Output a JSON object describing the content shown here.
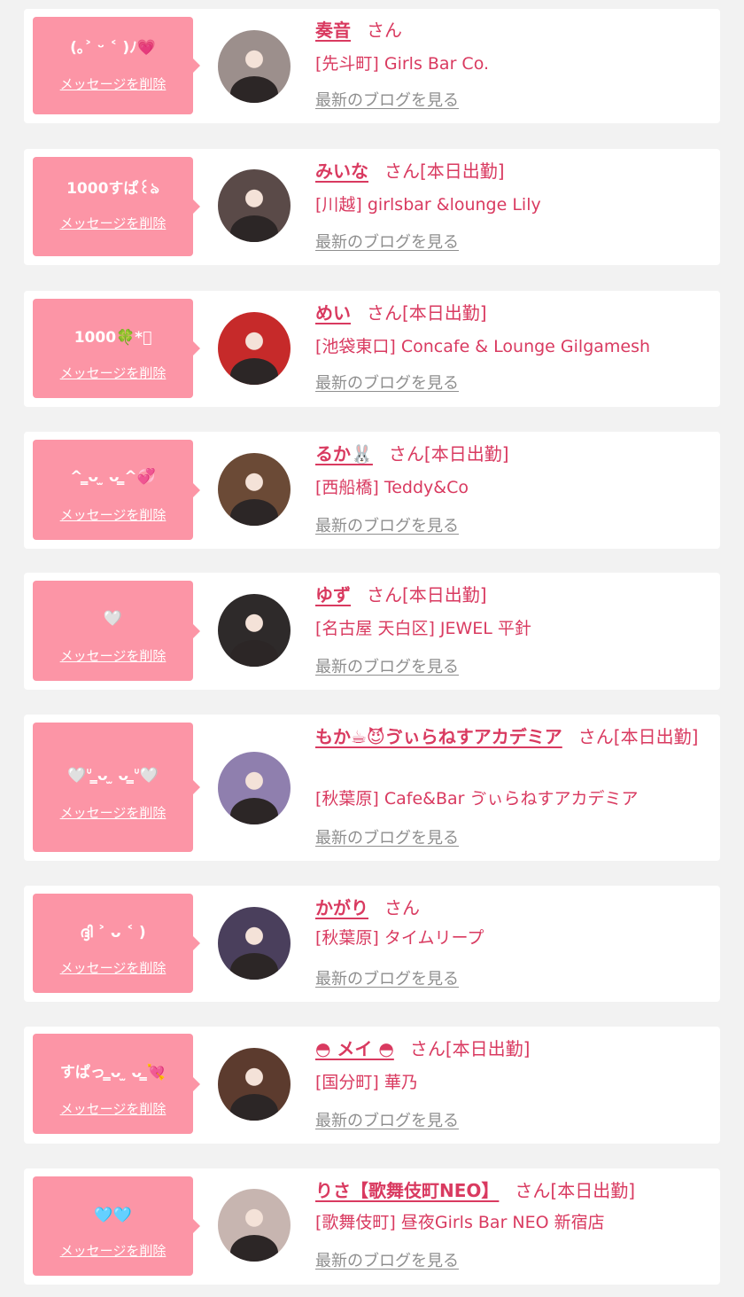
{
  "list": {
    "items": [
      {
        "message": "(｡˃ ᵕ ˂ )ﾉ💗",
        "delete_label": "メッセージを削除",
        "name": "奏音",
        "suffix": "さん",
        "shop": "[先斗町] Girls Bar Co.",
        "blog_label": "最新のブログを見る",
        "avatar_bg": "#9c8f8c"
      },
      {
        "message": "1000すぱ꒰ঌ",
        "delete_label": "メッセージを削除",
        "name": "みいな",
        "suffix": "さん[本日出勤]",
        "shop": "[川越] girlsbar &lounge Lily",
        "blog_label": "最新のブログを見る",
        "avatar_bg": "#5a4a48"
      },
      {
        "message": "1000🍀*ﾟ",
        "delete_label": "メッセージを削除",
        "name": "めい",
        "suffix": "さん[本日出勤]",
        "shop": "[池袋東口] Concafe & Lounge Gilgamesh",
        "blog_label": "最新のブログを見る",
        "avatar_bg": "#c62a2a"
      },
      {
        "message": "^ ̳ᴗ  ̫ ᴗ ̳^💞",
        "delete_label": "メッセージを削除",
        "name": "るか🐰",
        "suffix": "さん[本日出勤]",
        "shop": "[西船橋] Teddy&Co",
        "blog_label": "最新のブログを見る",
        "avatar_bg": "#6b4a36"
      },
      {
        "message": "🤍",
        "delete_label": "メッセージを削除",
        "name": "ゆず",
        "suffix": "さん[本日出勤]",
        "shop": "[名古屋 天白区] JEWEL 平針",
        "blog_label": "最新のブログを見る",
        "avatar_bg": "#2e2a2a"
      },
      {
        "message": "🤍ᐡ ̳ᴗ ̫ ᴗ ̳ᐡ🤍",
        "delete_label": "メッセージを削除",
        "name": "もか☕😈ゔぃらねすアカデミア",
        "suffix": "さん[本日出勤]",
        "shop": "[秋葉原] Cafe&Bar ゔぃらねすアカデミア",
        "blog_label": "最新のブログを見る",
        "avatar_bg": "#8f7fae"
      },
      {
        "message": "ദ്ദി ˃ ᴗ ˂ )",
        "delete_label": "メッセージを削除",
        "name": "かがり",
        "suffix": "さん",
        "shop": "[秋葉原] タイムリープ",
        "blog_label": "最新のブログを見る",
        "avatar_bg": "#4a3f5c"
      },
      {
        "message": "すぱっ ̳ᴗ ̫ ᴗ ̳💘",
        "delete_label": "メッセージを削除",
        "name": "◓ メイ ◓",
        "suffix": "さん[本日出勤]",
        "shop": "[国分町] 華乃",
        "blog_label": "最新のブログを見る",
        "avatar_bg": "#5c3b2e"
      },
      {
        "message": "🩵🩵",
        "delete_label": "メッセージを削除",
        "name": "りさ【歌舞伎町NEO】",
        "suffix": "さん[本日出勤]",
        "shop": "[歌舞伎町] 昼夜Girls Bar NEO 新宿店",
        "blog_label": "最新のブログを見る",
        "avatar_bg": "#c7b5b0"
      }
    ]
  }
}
